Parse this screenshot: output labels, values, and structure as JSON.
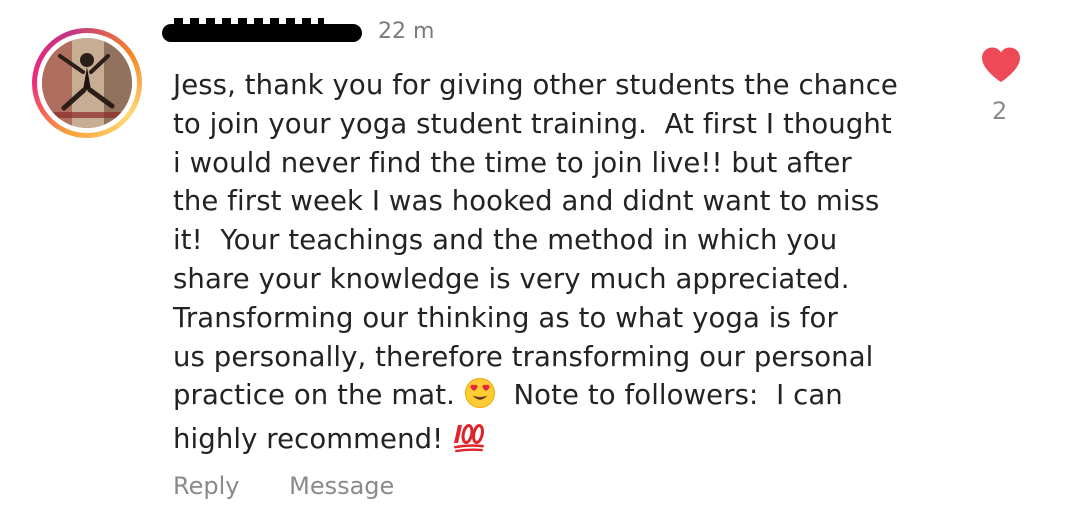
{
  "comment": {
    "username": "",
    "timestamp": "22 m",
    "lines": [
      "Jess, thank you for giving other students the chance",
      "to join your yoga student training.  At first I thought",
      "i would never find the time to join live!! but after",
      "the first week I was hooked and didnt want to miss",
      "it!  Your teachings and the method in which you",
      "share your knowledge is very much appreciated.",
      "Transforming our thinking as to what yoga is for",
      "us personally, therefore transforming our personal"
    ],
    "line9_before_emoji": "practice on the mat. ",
    "line9_after_emoji": "  Note to followers:  I can",
    "line10_text": "highly recommend! ",
    "emojis": [
      "heart-eyes-emoji",
      "hundred-points-emoji"
    ]
  },
  "actions": {
    "reply": "Reply",
    "message": "Message"
  },
  "like": {
    "count": "2",
    "icon": "heart-icon",
    "color": "#ed4956"
  },
  "avatar": {
    "ring_colors": [
      "#f9a13a",
      "#ee2a7b",
      "#c13584"
    ]
  }
}
